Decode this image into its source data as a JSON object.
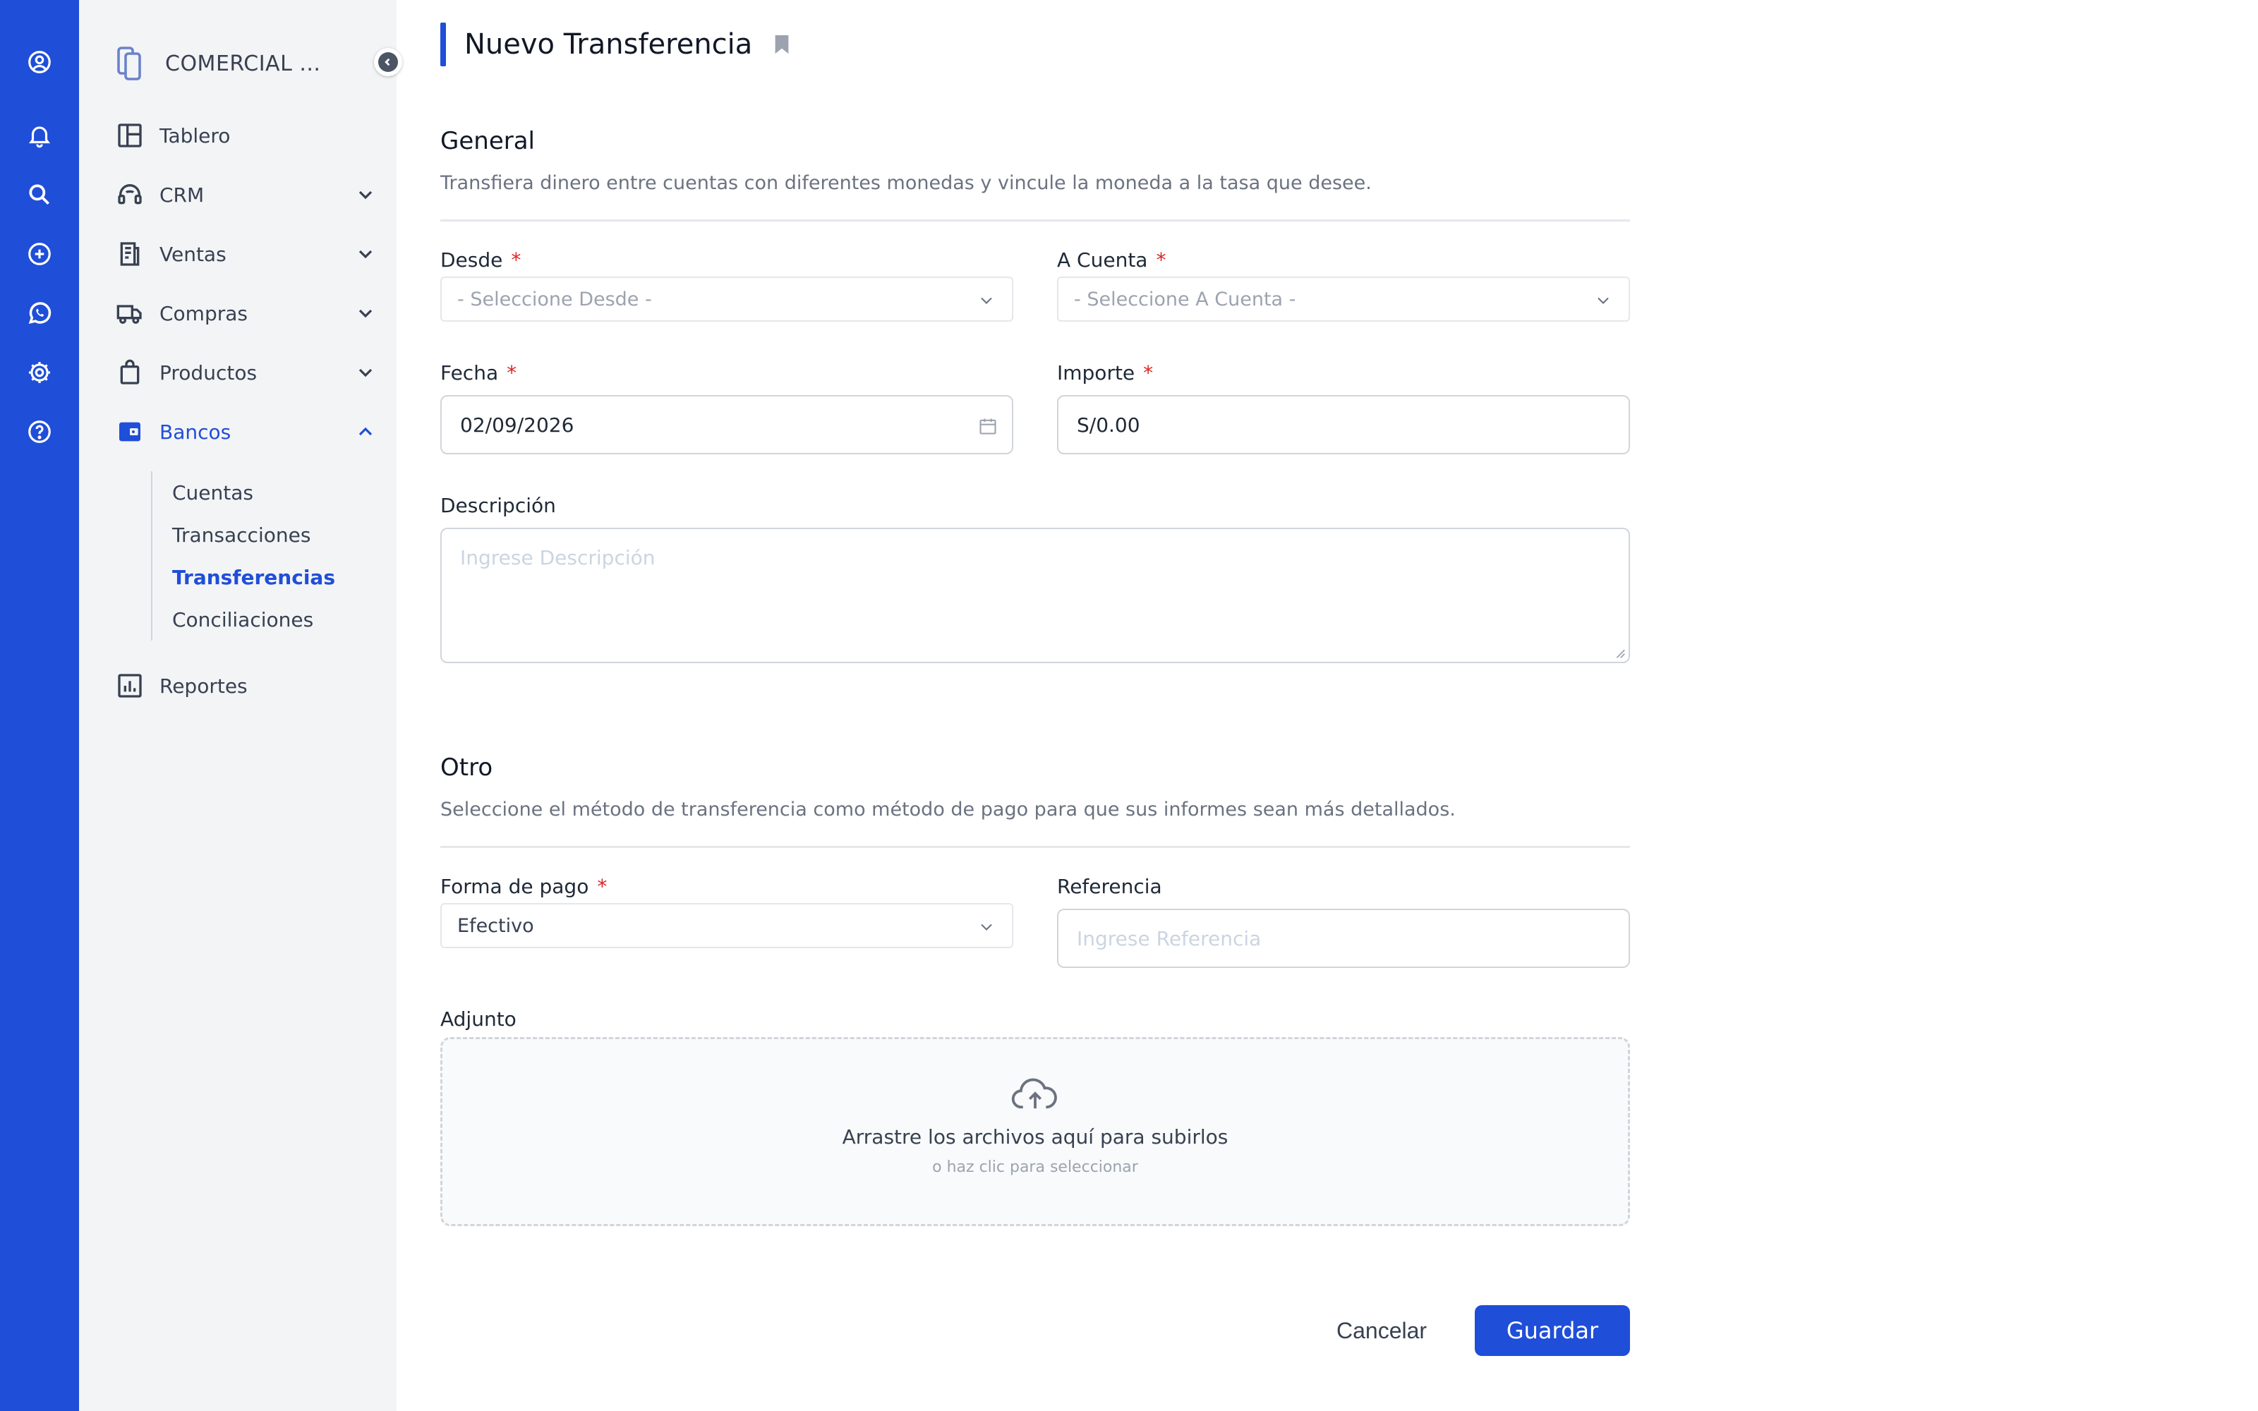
{
  "rail": {
    "icons": [
      "user-circle-icon",
      "bell-icon",
      "search-icon",
      "plus-circle-icon",
      "whatsapp-icon",
      "gear-icon",
      "help-icon"
    ]
  },
  "sidebar": {
    "company": "COMERCIAL ...",
    "items": [
      {
        "label": "Tablero",
        "icon": "dashboard-icon"
      },
      {
        "label": "CRM",
        "icon": "headset-icon"
      },
      {
        "label": "Ventas",
        "icon": "receipt-icon"
      },
      {
        "label": "Compras",
        "icon": "truck-icon"
      },
      {
        "label": "Productos",
        "icon": "bag-icon"
      },
      {
        "label": "Bancos",
        "icon": "wallet-icon"
      },
      {
        "label": "Reportes",
        "icon": "chart-icon"
      }
    ],
    "subitems": [
      "Cuentas",
      "Transacciones",
      "Transferencias",
      "Conciliaciones"
    ]
  },
  "page": {
    "title": "Nuevo Transferencia"
  },
  "general": {
    "title": "General",
    "description": "Transfiera dinero entre cuentas con diferentes monedas y vincule la moneda a la tasa que desee.",
    "from_label": "Desde",
    "from_placeholder": "- Seleccione Desde -",
    "to_label": "A Cuenta",
    "to_placeholder": "- Seleccione A Cuenta -",
    "date_label": "Fecha",
    "date_value": "02/09/2026",
    "amount_label": "Importe",
    "amount_value": "S/0.00",
    "description_label": "Descripción",
    "description_placeholder": "Ingrese Descripción"
  },
  "other": {
    "title": "Otro",
    "description": "Seleccione el método de transferencia como método de pago para que sus informes sean más detallados.",
    "payment_label": "Forma de pago",
    "payment_value": "Efectivo",
    "reference_label": "Referencia",
    "reference_placeholder": "Ingrese Referencia",
    "attachment_label": "Adjunto",
    "dropzone_text": "Arrastre los archivos aquí para subirlos",
    "dropzone_subtext": "o haz clic para seleccionar"
  },
  "actions": {
    "cancel": "Cancelar",
    "save": "Guardar"
  },
  "required_mark": "*",
  "colors": {
    "brand": "#1f4ed8",
    "required": "#dc2626",
    "sidebar_bg": "#f3f4f6"
  }
}
